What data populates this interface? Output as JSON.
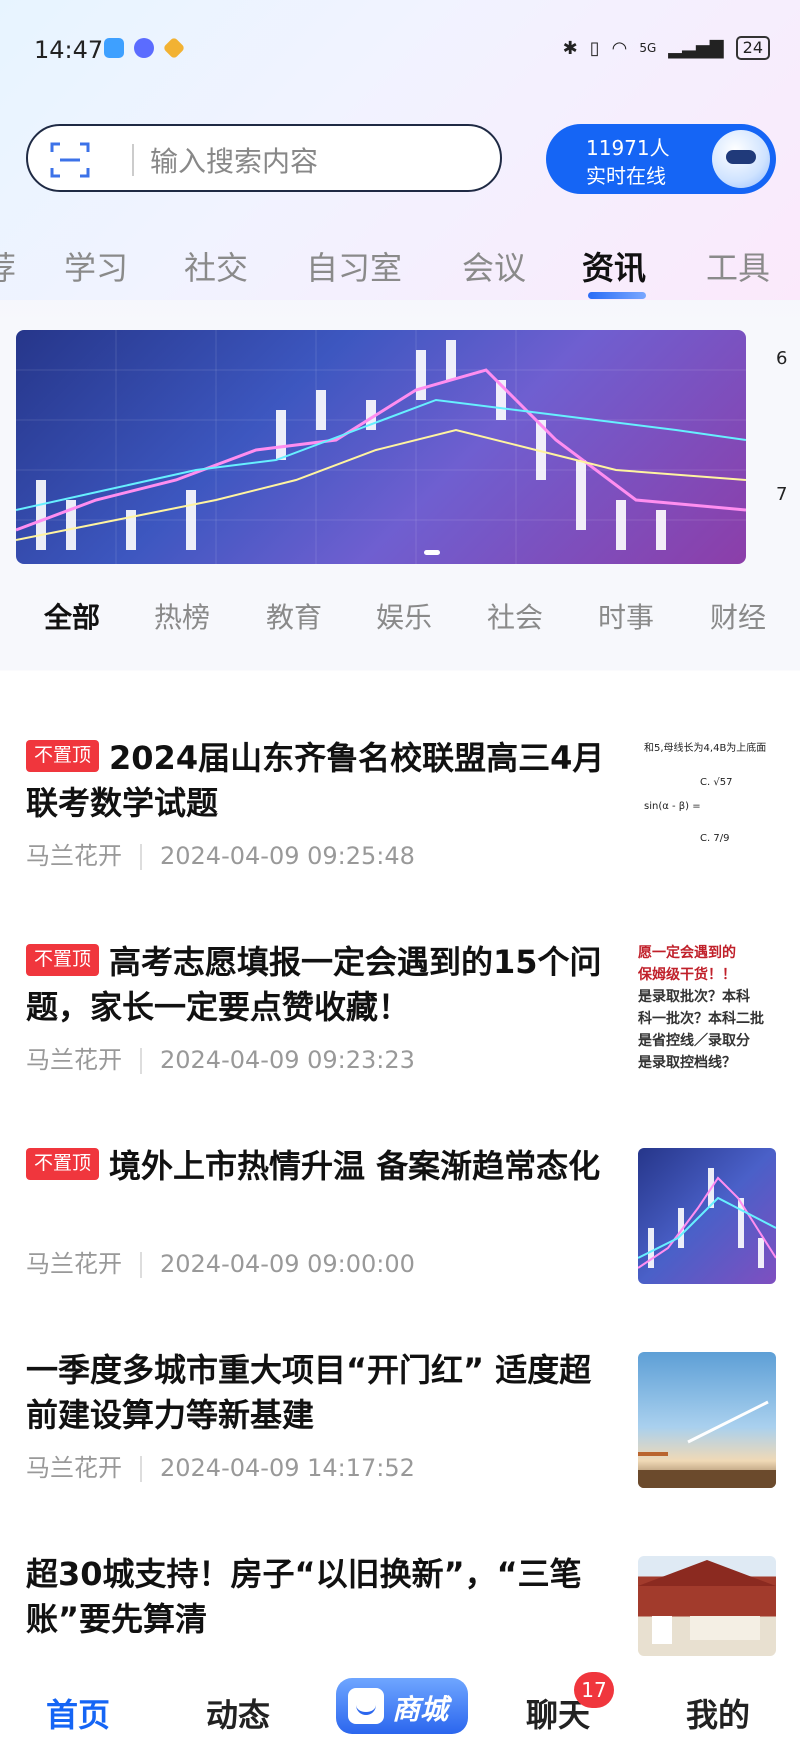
{
  "status_bar": {
    "time": "14:47",
    "network": "5G",
    "battery": "24"
  },
  "search": {
    "placeholder": "输入搜索内容"
  },
  "online": {
    "count": "11971人",
    "label": "实时在线"
  },
  "main_tabs": [
    {
      "label": "荐",
      "active": false
    },
    {
      "label": "学习",
      "active": false
    },
    {
      "label": "社交",
      "active": false
    },
    {
      "label": "自习室",
      "active": false
    },
    {
      "label": "会议",
      "active": false
    },
    {
      "label": "资讯",
      "active": true
    },
    {
      "label": "工具",
      "active": false
    }
  ],
  "banner_peek": [
    "6",
    "7"
  ],
  "sub_tabs": [
    {
      "label": "全部",
      "active": true
    },
    {
      "label": "热榜",
      "active": false
    },
    {
      "label": "教育",
      "active": false
    },
    {
      "label": "娱乐",
      "active": false
    },
    {
      "label": "社会",
      "active": false
    },
    {
      "label": "时事",
      "active": false
    },
    {
      "label": "财经",
      "active": false
    }
  ],
  "news": [
    {
      "tag": "不置顶",
      "title": "2024届山东齐鲁名校联盟高三4月联考数学试题",
      "author": "马兰花开",
      "time": "2024-04-09 09:25:48"
    },
    {
      "tag": "不置顶",
      "title": "高考志愿填报一定会遇到的15个问题，家长一定要点赞收藏！",
      "author": "马兰花开",
      "time": "2024-04-09 09:23:23"
    },
    {
      "tag": "不置顶",
      "title": "境外上市热情升温 备案渐趋常态化",
      "author": "马兰花开",
      "time": "2024-04-09 09:00:00"
    },
    {
      "tag": "",
      "title": "一季度多城市重大项目“开门红” 适度超前建设算力等新基建",
      "author": "马兰花开",
      "time": "2024-04-09 14:17:52"
    },
    {
      "tag": "",
      "title": "超30城支持！房子“以旧换新”，“三笔账”要先算清",
      "author": "",
      "time": ""
    }
  ],
  "thumb_texts": {
    "math": [
      "和5,母线长为4,4B为上底面",
      "C. √57",
      "sin(α - β) =",
      "C. 7/9"
    ],
    "poster": [
      "愿一定会遇到的",
      "保姆级干货！！",
      "是录取批次？本科",
      "科一批次？本科二批",
      "是省控线／录取分",
      "是录取控档线？"
    ]
  },
  "bottom_nav": {
    "home": "首页",
    "feed": "动态",
    "shop": "商城",
    "chat": "聊天",
    "chat_badge": "17",
    "me": "我的"
  },
  "colors": {
    "accent": "#1565f5",
    "tag": "#f0363d"
  }
}
